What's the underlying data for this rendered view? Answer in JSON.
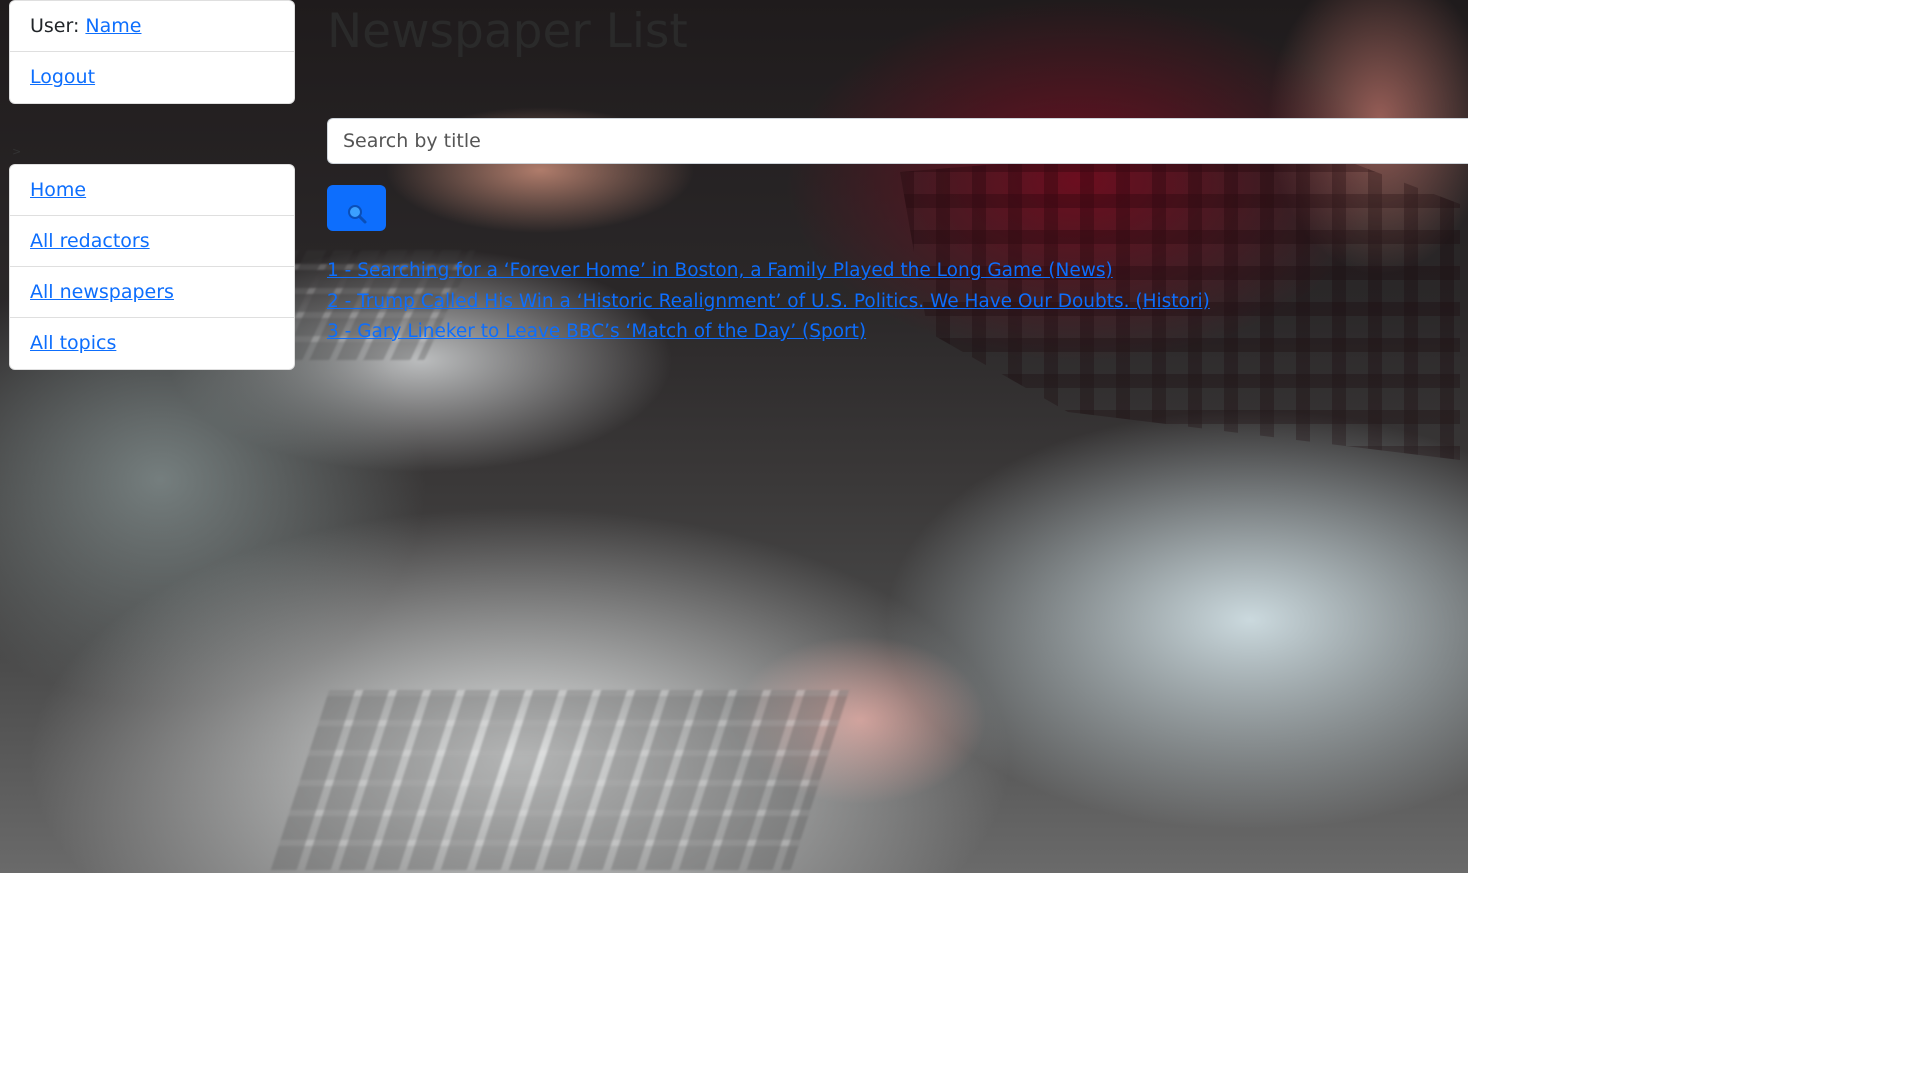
{
  "user": {
    "prefix": "User: ",
    "name": "Name",
    "logout_label": "Logout"
  },
  "nav": {
    "items": [
      {
        "label": "Home"
      },
      {
        "label": "All redactors"
      },
      {
        "label": "All newspapers"
      },
      {
        "label": "All topics"
      }
    ]
  },
  "page": {
    "title": "Newspaper List"
  },
  "search": {
    "placeholder": "Search by title",
    "value": "",
    "button_icon": "search-icon"
  },
  "newspapers": [
    {
      "text": "1 - Searching for a ‘Forever Home’ in Boston, a Family Played the Long Game (News)"
    },
    {
      "text": "2 - Trump Called His Win a ‘Historic Realignment’ of U.S. Politics. We Have Our Doubts. (Histori)"
    },
    {
      "text": "3 - Gary Lineker to Leave BBC’s ‘Match of the Day’ (Sport)"
    }
  ],
  "colors": {
    "link": "#0d6efd",
    "button": "#0d6efd",
    "card_bg": "#ffffff"
  }
}
